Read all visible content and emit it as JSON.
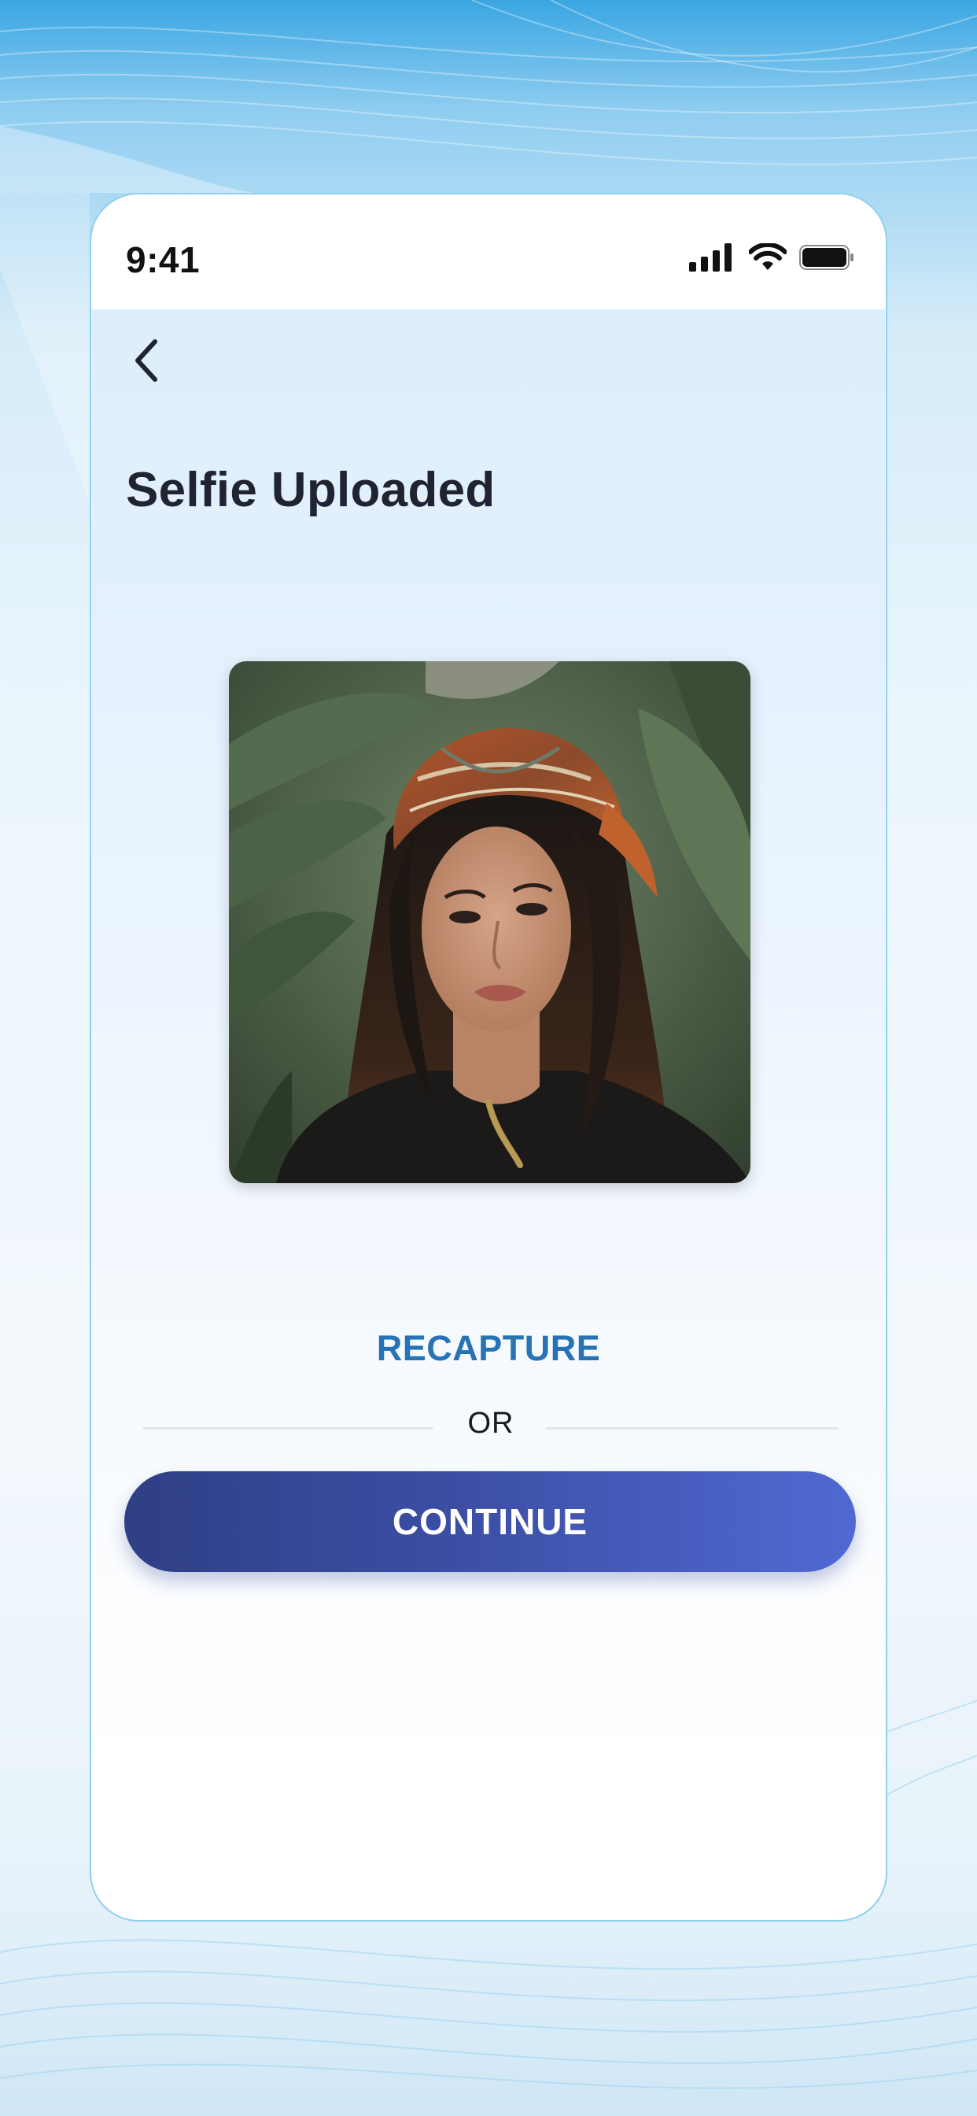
{
  "status_bar": {
    "time": "9:41",
    "icons": [
      "cellular-signal-icon",
      "wifi-icon",
      "battery-icon"
    ]
  },
  "header": {
    "back_icon": "chevron-left-icon",
    "title": "Selfie Uploaded"
  },
  "main": {
    "photo": {
      "subject": "selfie-photo"
    },
    "recapture_label": "RECAPTURE",
    "divider_label": "OR",
    "continue_label": "CONTINUE"
  },
  "colors": {
    "accent_link": "#2872b6",
    "button_gradient_start": "#2e3f85",
    "button_gradient_end": "#5069d3",
    "title_text": "#1f2430"
  }
}
